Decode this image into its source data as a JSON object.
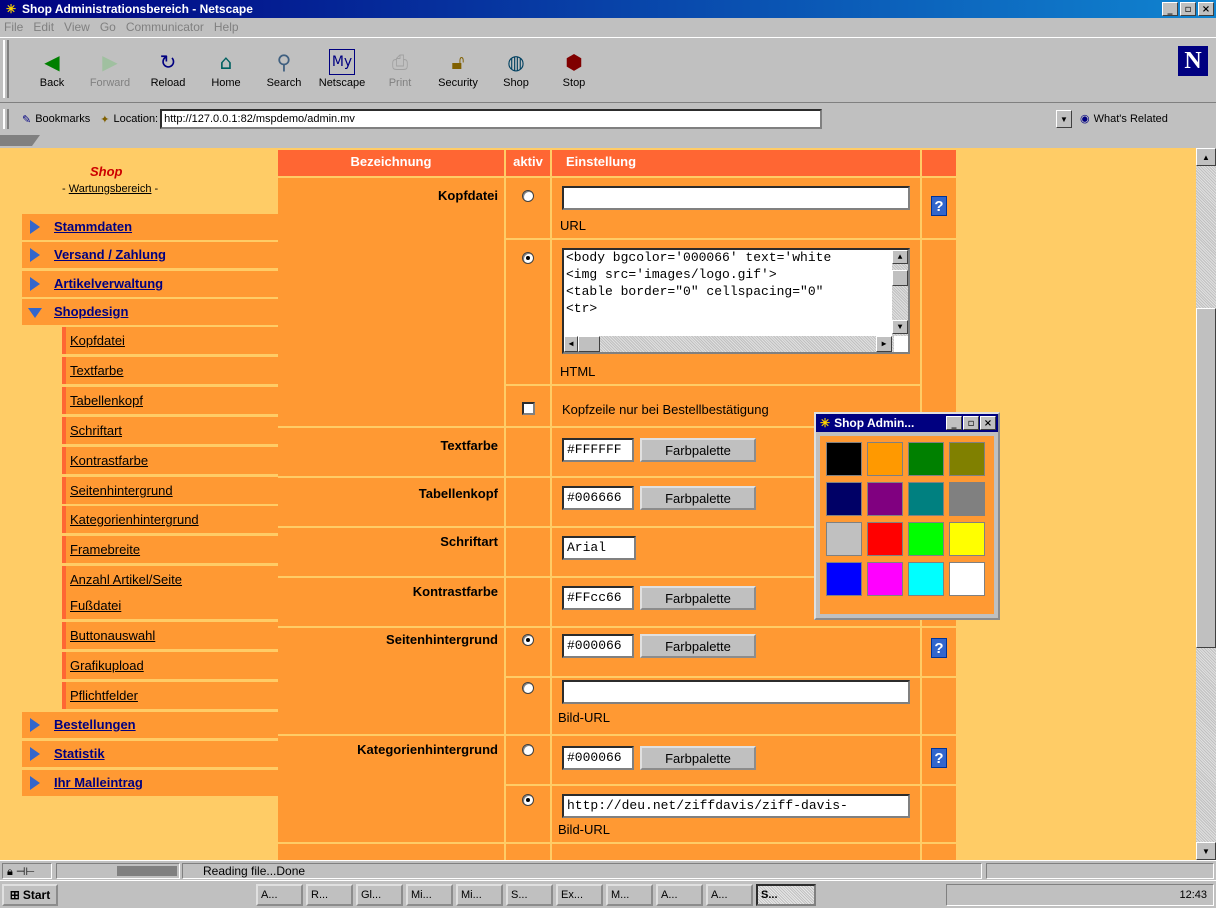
{
  "window": {
    "title": "Shop Administrationsbereich - Netscape"
  },
  "menu": [
    "File",
    "Edit",
    "View",
    "Go",
    "Communicator",
    "Help"
  ],
  "toolbar": {
    "buttons": [
      {
        "label": "Back",
        "icon": "back-arrow-icon"
      },
      {
        "label": "Forward",
        "icon": "forward-arrow-icon"
      },
      {
        "label": "Reload",
        "icon": "reload-icon"
      },
      {
        "label": "Home",
        "icon": "home-icon"
      },
      {
        "label": "Search",
        "icon": "search-icon"
      },
      {
        "label": "Netscape",
        "icon": "netscape-icon"
      },
      {
        "label": "Print",
        "icon": "print-icon"
      },
      {
        "label": "Security",
        "icon": "lock-icon"
      },
      {
        "label": "Shop",
        "icon": "shop-icon"
      },
      {
        "label": "Stop",
        "icon": "stop-icon"
      }
    ]
  },
  "location": {
    "bookmarks_label": "Bookmarks",
    "location_label": "Location:",
    "url": "http://127.0.0.1:82/mspdemo/admin.mv",
    "related_label": "What's Related"
  },
  "sidebar": {
    "title": "Shop",
    "subtitle_link": "Wartungsbereich",
    "items": [
      {
        "label": "Stammdaten"
      },
      {
        "label": "Versand / Zahlung"
      },
      {
        "label": "Artikelverwaltung"
      },
      {
        "label": "Shopdesign"
      }
    ],
    "subitems": [
      "Kopfdatei",
      "Textfarbe",
      "Tabellenkopf",
      "Schriftart",
      "Kontrastfarbe",
      "Seitenhintergrund",
      "Kategorienhintergrund",
      "Framebreite",
      "Anzahl Artikel/Seite",
      "Fußdatei",
      "Buttonauswahl",
      "Grafikupload",
      "Pflichtfelder"
    ],
    "bottom_items": [
      {
        "label": "Bestellungen"
      },
      {
        "label": "Statistik"
      },
      {
        "label": "Ihr Malleintrag"
      }
    ]
  },
  "table": {
    "headers": {
      "name": "Bezeichnung",
      "active": "aktiv",
      "setting": "Einstellung"
    },
    "kopfdatei": {
      "label": "Kopfdatei",
      "url_caption": "URL",
      "html_lines": [
        "<body bgcolor='000066' text='white",
        "<img src='images/logo.gif'>",
        "<table border=\"0\" cellspacing=\"0\"",
        "<tr>"
      ],
      "html_caption": "HTML",
      "checkbox_label": "Kopfzeile nur bei Bestellbestätigung"
    },
    "textfarbe": {
      "label": "Textfarbe",
      "value": "#FFFFFF"
    },
    "tabellenkopf": {
      "label": "Tabellenkopf",
      "value": "#006666"
    },
    "schriftart": {
      "label": "Schriftart",
      "value": "Arial"
    },
    "kontrastfarbe": {
      "label": "Kontrastfarbe",
      "value": "#FFcc66"
    },
    "seitenhintergrund": {
      "label": "Seitenhintergrund",
      "value": "#000066",
      "caption": "Bild-URL"
    },
    "kategorienhintergrund": {
      "label": "Kategorienhintergrund",
      "value": "#000066",
      "url": "http://deu.net/ziffdavis/ziff-davis-",
      "caption": "Bild-URL"
    },
    "palette_button": "Farbpalette",
    "help": "?"
  },
  "popup": {
    "title": "Shop Admin...",
    "colors": [
      "#000000",
      "#ff9900",
      "#008000",
      "#808000",
      "#000066",
      "#800080",
      "#008080",
      "#808080",
      "#c0c0c0",
      "#ff0000",
      "#00ff00",
      "#ffff00",
      "#0000ff",
      "#ff00ff",
      "#00ffff",
      "#ffffff"
    ]
  },
  "status": {
    "text": "Reading file...Done"
  },
  "taskbar": {
    "start": "Start",
    "tasks": [
      "A...",
      "R...",
      "Gl...",
      "Mi...",
      "Mi...",
      "S...",
      "Ex...",
      "M...",
      "A...",
      "A...",
      "S..."
    ],
    "clock": "12:43"
  }
}
